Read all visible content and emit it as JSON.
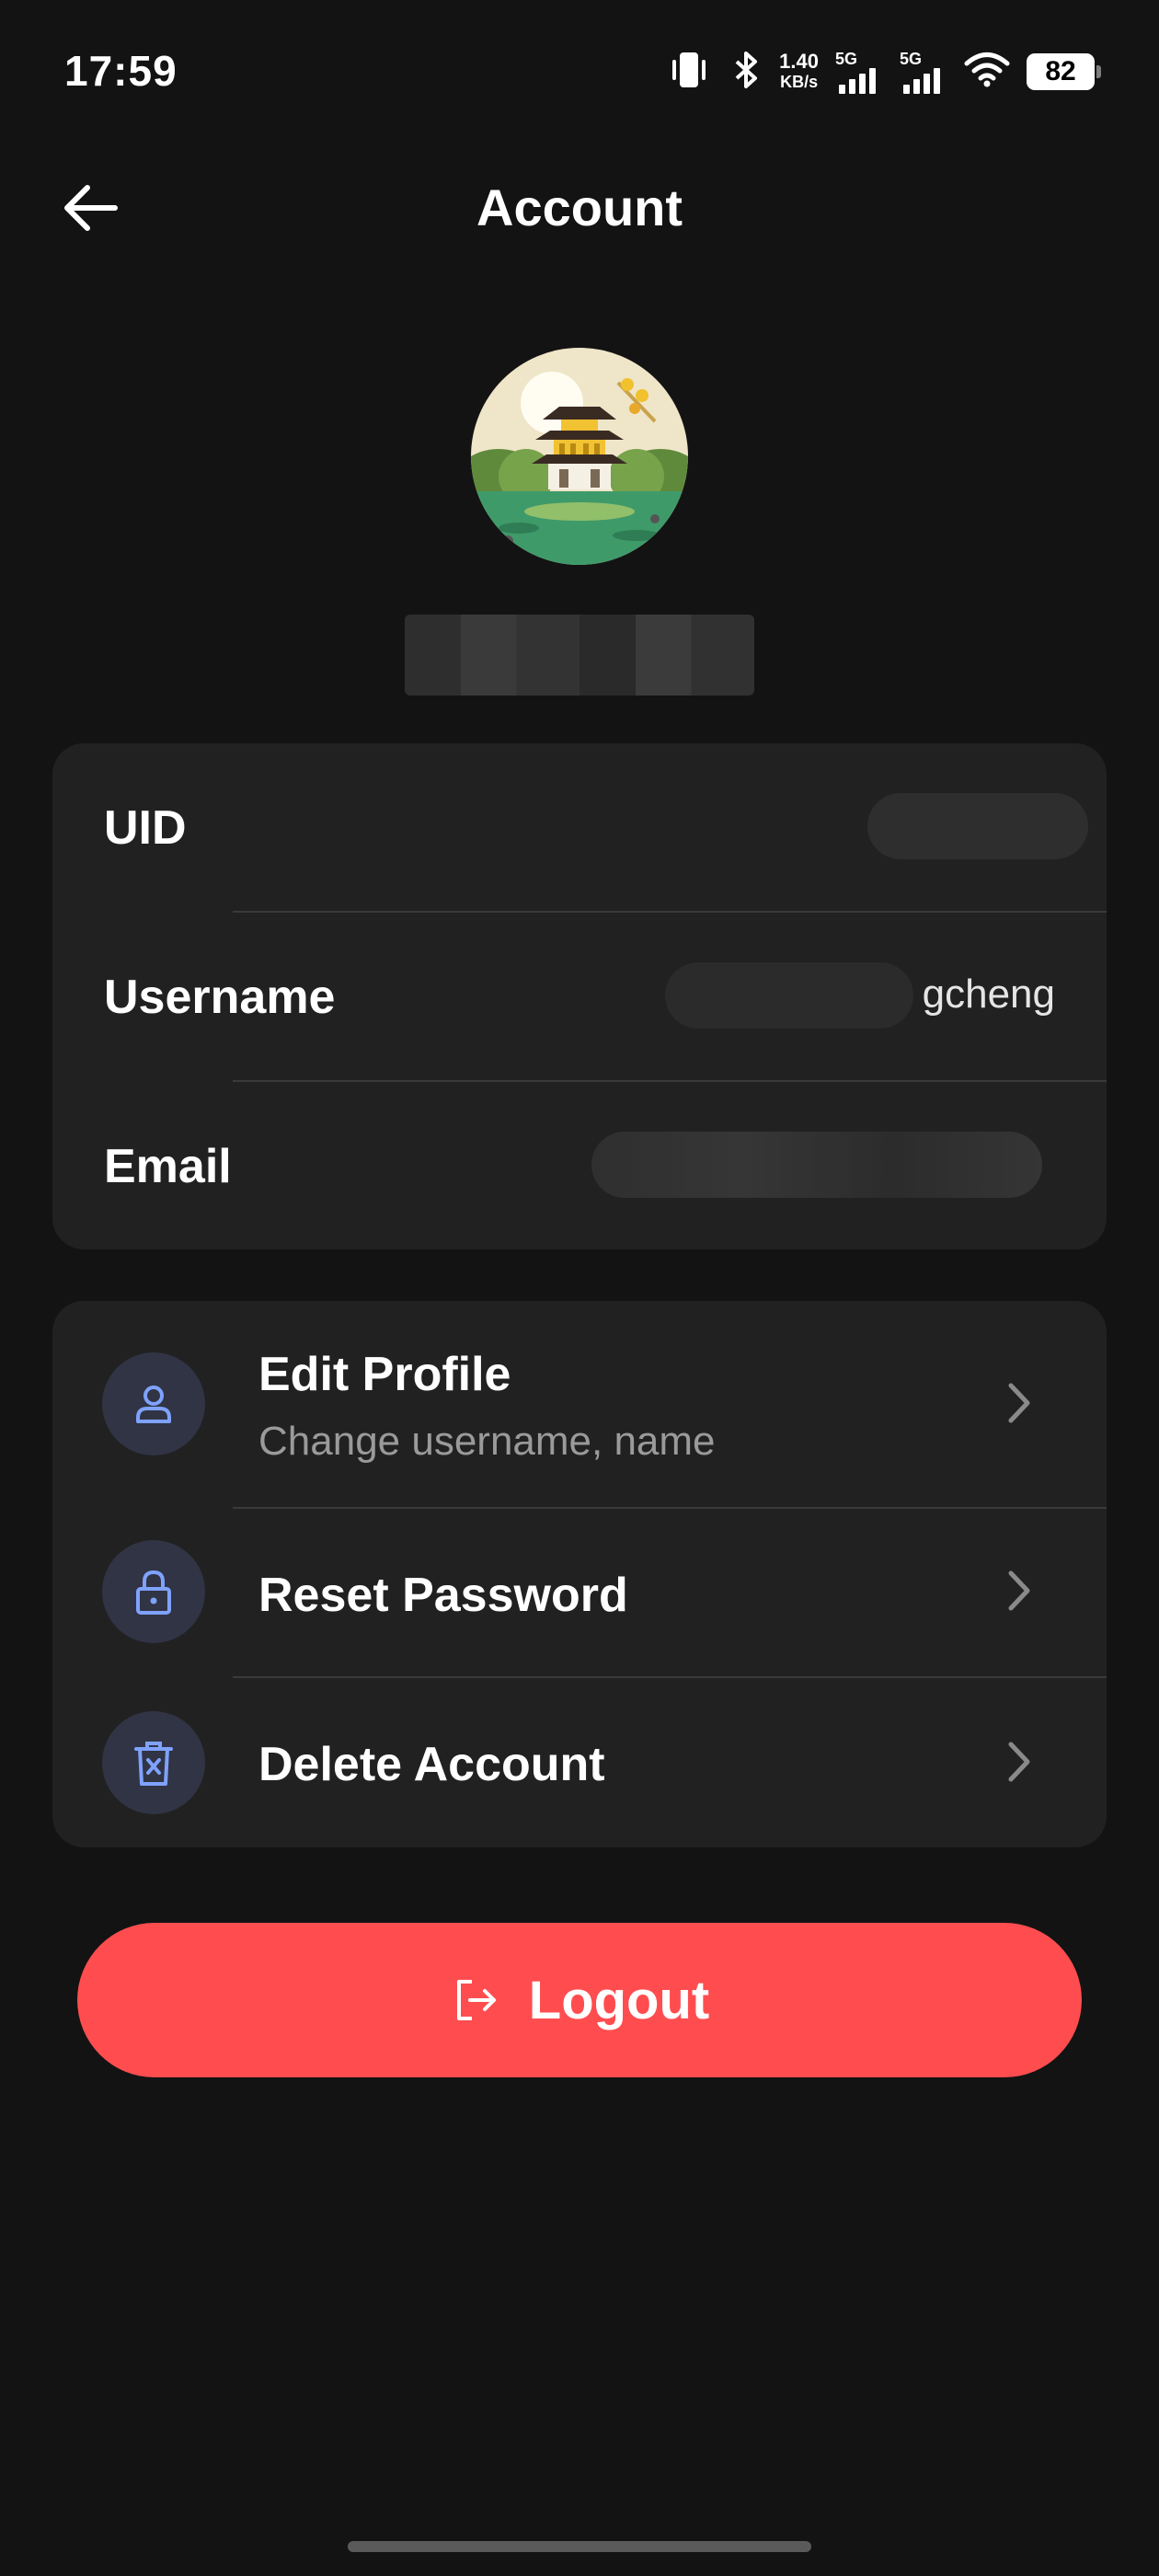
{
  "status_bar": {
    "time": "17:59",
    "net_speed_value": "1.40",
    "net_speed_unit": "KB/s",
    "sim1": "5G",
    "sim2": "5G",
    "battery": "82"
  },
  "header": {
    "title": "Account"
  },
  "profile": {
    "display_name_redacted": true
  },
  "info": {
    "uid_label": "UID",
    "username_label": "Username",
    "username_value_partial": "gcheng",
    "email_label": "Email"
  },
  "menu": {
    "edit_profile_label": "Edit Profile",
    "edit_profile_sub": "Change username, name",
    "reset_password_label": "Reset Password",
    "delete_account_label": "Delete Account"
  },
  "logout_label": "Logout",
  "colors": {
    "background": "#131313",
    "card": "#212121",
    "icon_circle": "#303444",
    "icon_accent": "#7fa2ff",
    "logout": "#ff4d4f"
  }
}
